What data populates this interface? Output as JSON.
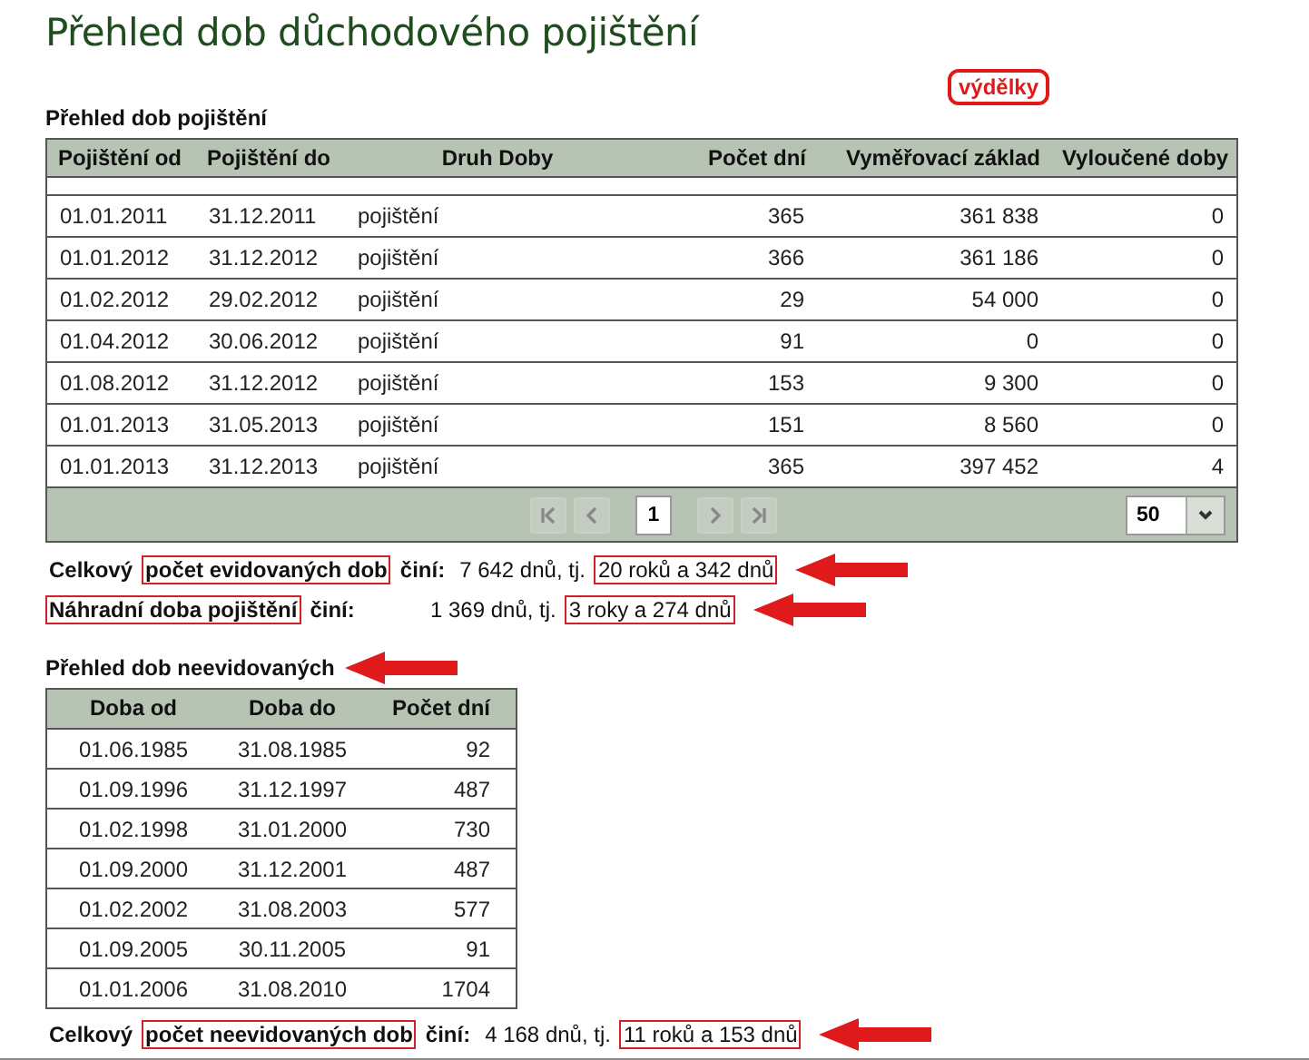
{
  "title": "Přehled dob důchodového pojištění",
  "insured": {
    "heading": "Přehled dob pojištění",
    "callout": "výdělky",
    "columns": [
      "Pojištění od",
      "Pojištění do",
      "Druh Doby",
      "Počet dní",
      "Vyměřovací základ",
      "Vyloučené doby"
    ],
    "rows": [
      [
        "01.01.2011",
        "31.12.2011",
        "pojištění",
        "365",
        "361 838",
        "0"
      ],
      [
        "01.01.2012",
        "31.12.2012",
        "pojištění",
        "366",
        "361 186",
        "0"
      ],
      [
        "01.02.2012",
        "29.02.2012",
        "pojištění",
        "29",
        "54 000",
        "0"
      ],
      [
        "01.04.2012",
        "30.06.2012",
        "pojištění",
        "91",
        "0",
        "0"
      ],
      [
        "01.08.2012",
        "31.12.2012",
        "pojištění",
        "153",
        "9 300",
        "0"
      ],
      [
        "01.01.2013",
        "31.05.2013",
        "pojištění",
        "151",
        "8 560",
        "0"
      ],
      [
        "01.01.2013",
        "31.12.2013",
        "pojištění",
        "365",
        "397 452",
        "4"
      ]
    ],
    "pager": {
      "page": "1",
      "page_size": "50"
    }
  },
  "summary": [
    {
      "label": [
        {
          "text": "Celkový",
          "highlighted": false
        },
        {
          "text": "počet evidovaných dob",
          "highlighted": true
        },
        {
          "text": "činí:",
          "highlighted": false
        }
      ],
      "value": [
        {
          "text": "7 642 dnů, tj.",
          "highlighted": false
        },
        {
          "text": "20 roků a 342 dnů",
          "highlighted": true
        }
      ],
      "arrow": true
    },
    {
      "label": [
        {
          "text": "Náhradní doba pojištění",
          "highlighted": true
        },
        {
          "text": "činí:",
          "highlighted": false
        }
      ],
      "value": [
        {
          "text": "1 369 dnů, tj.",
          "highlighted": false
        },
        {
          "text": "3 roky a 274 dnů",
          "highlighted": true
        }
      ],
      "arrow": true
    }
  ],
  "uninsured": {
    "heading": "Přehled dob neevidovaných",
    "arrow": true,
    "columns": [
      "Doba od",
      "Doba do",
      "Počet dní"
    ],
    "rows": [
      [
        "01.06.1985",
        "31.08.1985",
        "92"
      ],
      [
        "01.09.1996",
        "31.12.1997",
        "487"
      ],
      [
        "01.02.1998",
        "31.01.2000",
        "730"
      ],
      [
        "01.09.2000",
        "31.12.2001",
        "487"
      ],
      [
        "01.02.2002",
        "31.08.2003",
        "577"
      ],
      [
        "01.09.2005",
        "30.11.2005",
        "91"
      ],
      [
        "01.01.2006",
        "31.08.2010",
        "1704"
      ]
    ],
    "summary": {
      "label": [
        {
          "text": "Celkový",
          "highlighted": false
        },
        {
          "text": "počet neevidovaných dob",
          "highlighted": true
        },
        {
          "text": "činí:",
          "highlighted": false
        }
      ],
      "value": [
        {
          "text": "4 168 dnů, tj.",
          "highlighted": false
        },
        {
          "text": "11 roků a 153 dnů",
          "highlighted": true
        }
      ],
      "arrow": true
    }
  }
}
